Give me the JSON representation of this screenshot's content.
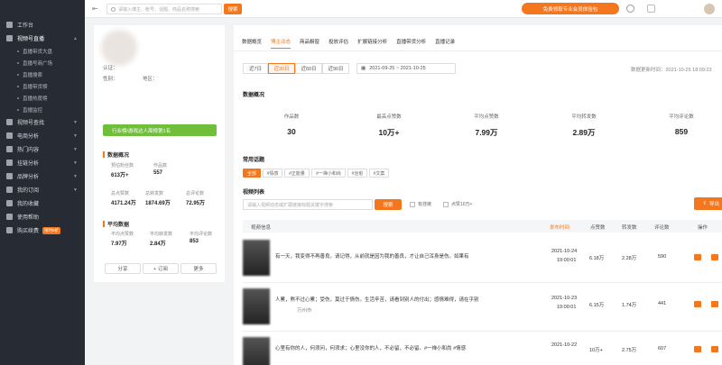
{
  "sidebar": {
    "items": [
      {
        "label": "工作台",
        "icon": "home-icon"
      },
      {
        "label": "视频号直播",
        "icon": "live-icon",
        "open": true
      },
      {
        "label": "视频号查找",
        "icon": "search-video-icon"
      },
      {
        "label": "电商分析",
        "icon": "cart-icon"
      },
      {
        "label": "热门内容",
        "icon": "fire-icon"
      },
      {
        "label": "挂链分析",
        "icon": "link-icon"
      },
      {
        "label": "品牌分析",
        "icon": "brand-icon"
      },
      {
        "label": "我的订阅",
        "icon": "subscribe-icon"
      },
      {
        "label": "我的收藏",
        "icon": "star-icon"
      },
      {
        "label": "使用帮助",
        "icon": "help-icon"
      },
      {
        "label": "购买续费",
        "icon": "cart-icon",
        "badge": "限时5折"
      }
    ],
    "sub_items": [
      "直播带货大盘",
      "直播号商广场",
      "直播搜索",
      "直播带货榜",
      "直播热度榜",
      "直播监控"
    ]
  },
  "topbar": {
    "search_placeholder": "请输入博主、帐号、话题、商品名称搜索",
    "search_button": "搜索",
    "promo": "免费领取专业会员体验包"
  },
  "profile": {
    "auth_label": "认证：",
    "gender_label": "性别：",
    "region_label": "地区：",
    "tag": "行业榜/游戏达人周榜第1名",
    "data_overview_title": "数据概况",
    "stats": [
      {
        "label": "预估粉丝数",
        "value": "613万+"
      },
      {
        "label": "作品数",
        "value": "557"
      },
      {
        "label": "总点赞数",
        "value": "4171.24万"
      },
      {
        "label": "总转发数",
        "value": "1874.69万"
      },
      {
        "label": "总评论数",
        "value": "72.95万"
      }
    ],
    "avg_title": "平均数据",
    "avg_stats": [
      {
        "label": "平均点赞数",
        "value": "7.97万"
      },
      {
        "label": "平均转发数",
        "value": "2.84万"
      },
      {
        "label": "平均评论数",
        "value": "853"
      }
    ],
    "buttons": {
      "share": "分享",
      "subscribe": "+ 订阅",
      "more": "更多"
    }
  },
  "main": {
    "tabs": [
      "数据概览",
      "博主动态",
      "商品橱窗",
      "投放评估",
      "扩展链接分析",
      "直播带货分析",
      "直播记录"
    ],
    "active_tab": 1,
    "ranges": [
      "近7日",
      "近30日",
      "近60日",
      "近90日"
    ],
    "active_range": 1,
    "date_range": "2021-09-25  ~  2021-10-25",
    "update_time": "数据更新时间：2021-10-25 18:09:23",
    "overview_title": "数据概况",
    "overview": [
      {
        "label": "作品数",
        "value": "30"
      },
      {
        "label": "最高点赞数",
        "value": "10万+"
      },
      {
        "label": "平均点赞数",
        "value": "7.99万"
      },
      {
        "label": "平均转发数",
        "value": "2.89万"
      },
      {
        "label": "平均评论数",
        "value": "859"
      }
    ],
    "topics_title": "常用话题",
    "topics": [
      "全部",
      "#情感",
      "#正能量",
      "#一禅小和尚",
      "#治愈",
      "#文案"
    ],
    "video_list_title": "视频列表",
    "video_search_placeholder": "请输入视频动态或扩展链接标题关键字搜索",
    "video_search_button": "搜索",
    "check_link": "有挂链",
    "check_likes": "点赞10万+",
    "export": "导出",
    "columns": [
      "视频信息",
      "发布时间",
      "点赞数",
      "转发数",
      "评论数",
      "操作"
    ],
    "rows": [
      {
        "text": "有一天，我变得不再善良。请记得，从前就是因为我的善良，才让自己浑身是伤。如果有",
        "date": "2021-10-24",
        "time": "19:00:01",
        "likes": "6.18万",
        "shares": "2.28万",
        "comments": "590",
        "location": ""
      },
      {
        "text": "人累，熬不过心累；受伤，莫过于情伤。生活辛苦，请看到别人的付出；感情难得，请在乎别",
        "date": "2021-10-23",
        "time": "19:00:01",
        "likes": "6.15万",
        "shares": "1.74万",
        "comments": "441",
        "location": "万州市"
      },
      {
        "text": "心里有你的人，何须问，何须求；心里没你的人，不必留，不必留。#一禅小和尚 #情感",
        "date": "2021-10-22",
        "time": "",
        "likes": "10万+",
        "shares": "2.75万",
        "comments": "607",
        "location": ""
      }
    ]
  }
}
